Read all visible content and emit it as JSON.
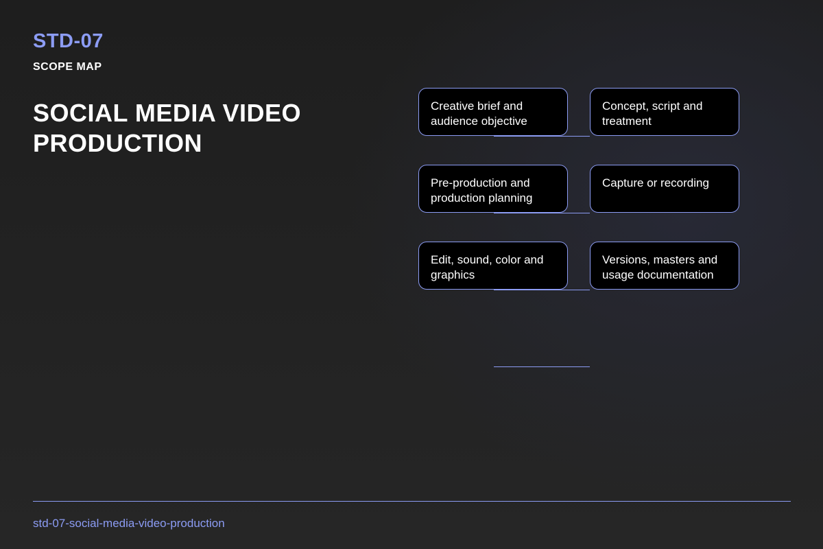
{
  "header": {
    "code": "STD-07",
    "subtitle": "SCOPE MAP",
    "title": "SOCIAL MEDIA VIDEO PRODUCTION"
  },
  "scope_items": [
    "Creative brief and audience objective",
    "Concept, script and treatment",
    "Pre-production and production planning",
    "Capture or recording",
    "Edit, sound, color and graphics",
    "Versions, masters and usage documentation"
  ],
  "footer": {
    "slug": "std-07-social-media-video-production"
  },
  "colors": {
    "accent": "#8c9cf4",
    "node_fill": "#000000",
    "background": "#222222"
  }
}
